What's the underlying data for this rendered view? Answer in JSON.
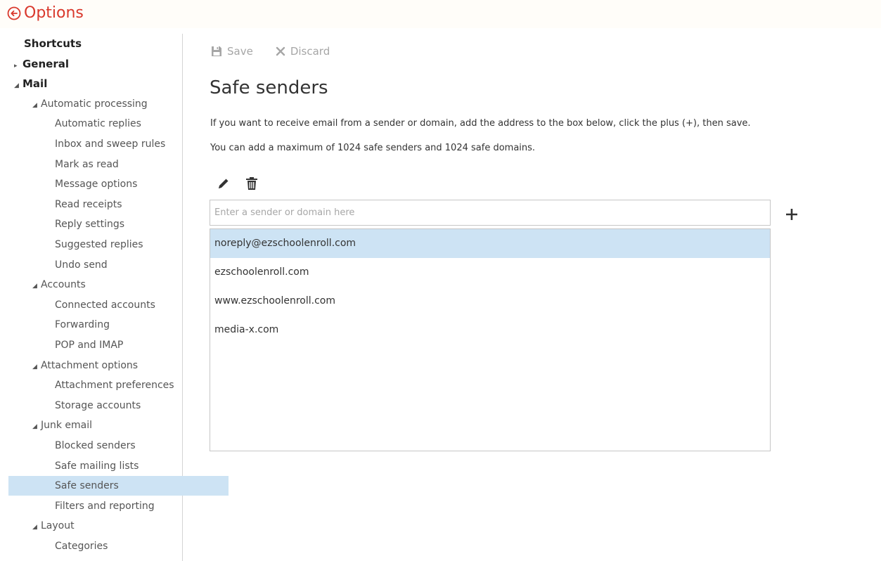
{
  "header": {
    "title": "Options",
    "back_icon": "circle-back-arrow-icon",
    "accent_color": "#d9382c"
  },
  "sidebar": {
    "selected_color": "#cde3f4",
    "items": [
      {
        "label": "Shortcuts",
        "level": "top",
        "arrow": ""
      },
      {
        "label": "General",
        "level": "top",
        "arrow": "▸"
      },
      {
        "label": "Mail",
        "level": "top",
        "arrow": "◢"
      },
      {
        "label": "Automatic processing",
        "level": "group",
        "arrow": "◢"
      },
      {
        "label": "Automatic replies",
        "level": "leaf",
        "arrow": ""
      },
      {
        "label": "Inbox and sweep rules",
        "level": "leaf",
        "arrow": ""
      },
      {
        "label": "Mark as read",
        "level": "leaf",
        "arrow": ""
      },
      {
        "label": "Message options",
        "level": "leaf",
        "arrow": ""
      },
      {
        "label": "Read receipts",
        "level": "leaf",
        "arrow": ""
      },
      {
        "label": "Reply settings",
        "level": "leaf",
        "arrow": ""
      },
      {
        "label": "Suggested replies",
        "level": "leaf",
        "arrow": ""
      },
      {
        "label": "Undo send",
        "level": "leaf",
        "arrow": ""
      },
      {
        "label": "Accounts",
        "level": "group",
        "arrow": "◢"
      },
      {
        "label": "Connected accounts",
        "level": "leaf",
        "arrow": ""
      },
      {
        "label": "Forwarding",
        "level": "leaf",
        "arrow": ""
      },
      {
        "label": "POP and IMAP",
        "level": "leaf",
        "arrow": ""
      },
      {
        "label": "Attachment options",
        "level": "group",
        "arrow": "◢"
      },
      {
        "label": "Attachment preferences",
        "level": "leaf",
        "arrow": ""
      },
      {
        "label": "Storage accounts",
        "level": "leaf",
        "arrow": ""
      },
      {
        "label": "Junk email",
        "level": "group",
        "arrow": "◢"
      },
      {
        "label": "Blocked senders",
        "level": "leaf",
        "arrow": ""
      },
      {
        "label": "Safe mailing lists",
        "level": "leaf",
        "arrow": ""
      },
      {
        "label": "Safe senders",
        "level": "leaf",
        "arrow": "",
        "selected": true
      },
      {
        "label": "Filters and reporting",
        "level": "leaf",
        "arrow": ""
      },
      {
        "label": "Layout",
        "level": "group",
        "arrow": "◢"
      },
      {
        "label": "Categories",
        "level": "leaf",
        "arrow": ""
      }
    ]
  },
  "toolbar": {
    "save_label": "Save",
    "discard_label": "Discard",
    "save_icon": "floppy-disk-icon",
    "discard_icon": "x-icon"
  },
  "main": {
    "title": "Safe senders",
    "description_1": "If you want to receive email from a sender or domain, add the address to the box below, click the plus (+), then save.",
    "description_2": "You can add a maximum of 1024 safe senders and 1024 safe domains.",
    "edit_icon": "pencil-icon",
    "delete_icon": "trash-icon",
    "input": {
      "placeholder": "Enter a sender or domain here",
      "value": ""
    },
    "add_icon": "plus-icon",
    "senders": [
      {
        "address": "noreply@ezschoolenroll.com",
        "selected": true
      },
      {
        "address": "ezschoolenroll.com",
        "selected": false
      },
      {
        "address": "www.ezschoolenroll.com",
        "selected": false
      },
      {
        "address": "media-x.com",
        "selected": false
      }
    ]
  }
}
